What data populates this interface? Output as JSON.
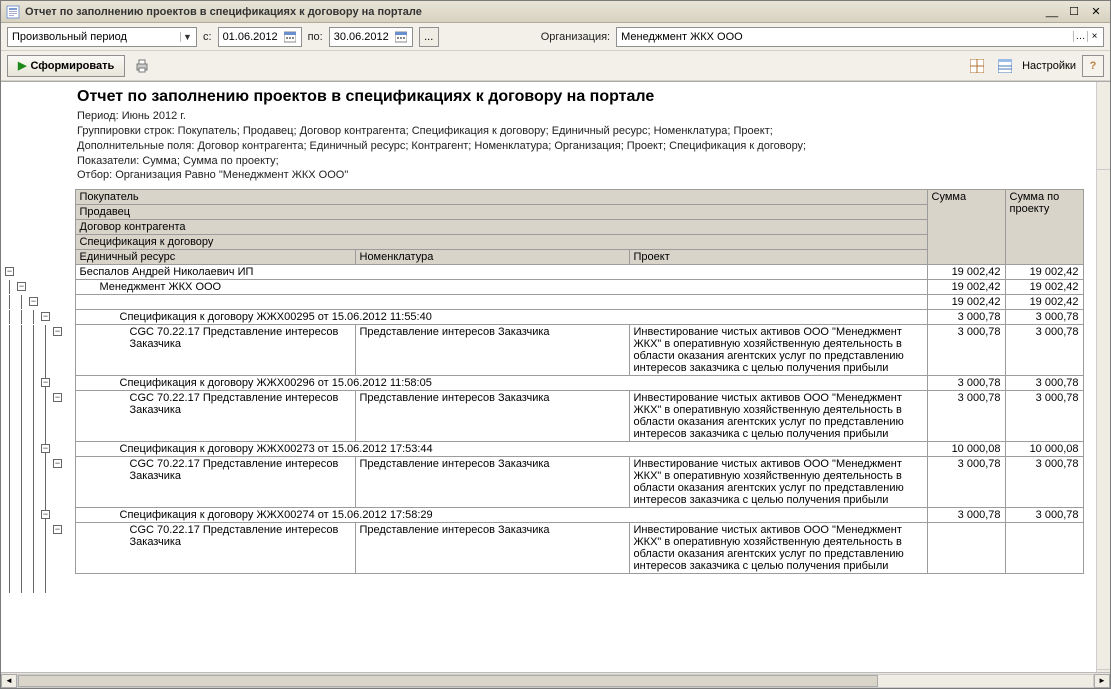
{
  "window": {
    "title": "Отчет по заполнению проектов в спецификациях к договору на портале"
  },
  "toolbar": {
    "period_combo": "Произвольный период",
    "from_lbl": "с:",
    "from_date": "01.06.2012",
    "to_lbl": "по:",
    "to_date": "30.06.2012",
    "org_lbl": "Организация:",
    "org_value": "Менеджмент ЖКХ ООО"
  },
  "toolbar2": {
    "form_btn": "Сформировать",
    "settings": "Настройки"
  },
  "report": {
    "title": "Отчет по заполнению проектов в спецификациях к договору на портале",
    "period": "Период: Июнь 2012 г.",
    "group_line": "Группировки строк: Покупатель; Продавец; Договор контрагента; Спецификация к договору; Единичный ресурс; Номенклатура; Проект;",
    "extra_line": "Дополнительные поля: Договор контрагента; Единичный ресурс; Контрагент; Номенклатура; Организация; Проект; Спецификация к договору;",
    "measures_line": "Показатели: Сумма; Сумма по проекту;",
    "filter_line": "Отбор: Организация Равно \"Менеджмент ЖКХ ООО\""
  },
  "cols": {
    "buyer": "Покупатель",
    "seller": "Продавец",
    "contract": "Договор контрагента",
    "spec": "Спецификация к договору",
    "resource": "Единичный ресурс",
    "nomen": "Номенклатура",
    "project": "Проект",
    "sum": "Сумма",
    "sum_proj": "Сумма по проекту"
  },
  "rows": {
    "buyer": {
      "label": "Беспалов Андрей Николаевич ИП",
      "sum": "19 002,42",
      "sum2": "19 002,42"
    },
    "seller": {
      "label": "Менеджмент ЖКХ ООО",
      "sum": "19 002,42",
      "sum2": "19 002,42"
    },
    "contract_blank": {
      "label": "",
      "sum": "19 002,42",
      "sum2": "19 002,42"
    },
    "specs": [
      {
        "label": "Спецификация к договору ЖЖХ00295 от 15.06.2012 11:55:40",
        "sum": "3 000,78",
        "sum2": "3 000,78",
        "detail": {
          "resource": "CGC 70.22.17 Представление интересов Заказчика",
          "nomen": "Представление интересов Заказчика",
          "project": "Инвестирование чистых активов ООО \"Менеджмент ЖКХ\" в оперативную хозяйственную деятельность в области оказания агентских услуг по представлению интересов заказчика с целью получения прибыли",
          "sum": "3 000,78",
          "sum2": "3 000,78"
        }
      },
      {
        "label": "Спецификация к договору ЖЖХ00296 от 15.06.2012 11:58:05",
        "sum": "3 000,78",
        "sum2": "3 000,78",
        "detail": {
          "resource": "CGC 70.22.17 Представление интересов Заказчика",
          "nomen": "Представление интересов Заказчика",
          "project": "Инвестирование чистых активов ООО \"Менеджмент ЖКХ\" в оперативную хозяйственную деятельность в области оказания агентских услуг по представлению интересов заказчика с целью получения прибыли",
          "sum": "3 000,78",
          "sum2": "3 000,78"
        }
      },
      {
        "label": "Спецификация к договору ЖЖХ00273 от 15.06.2012 17:53:44",
        "sum": "10 000,08",
        "sum2": "10 000,08",
        "detail": {
          "resource": "CGC 70.22.17 Представление интересов Заказчика",
          "nomen": "Представление интересов Заказчика",
          "project": "Инвестирование чистых активов ООО \"Менеджмент ЖКХ\" в оперативную хозяйственную деятельность в области оказания агентских услуг по представлению интересов заказчика с целью получения прибыли",
          "sum": "3 000,78",
          "sum2": "3 000,78"
        }
      },
      {
        "label": "Спецификация к договору ЖЖХ00274 от 15.06.2012 17:58:29",
        "sum": "3 000,78",
        "sum2": "3 000,78",
        "detail": {
          "resource": "CGC 70.22.17 Представление интересов Заказчика",
          "nomen": "Представление интересов Заказчика",
          "project": "Инвестирование чистых активов ООО \"Менеджмент ЖКХ\" в оперативную хозяйственную деятельность в области оказания агентских услуг по представлению интересов заказчика с целью получения прибыли",
          "sum": "",
          "sum2": ""
        }
      }
    ]
  }
}
